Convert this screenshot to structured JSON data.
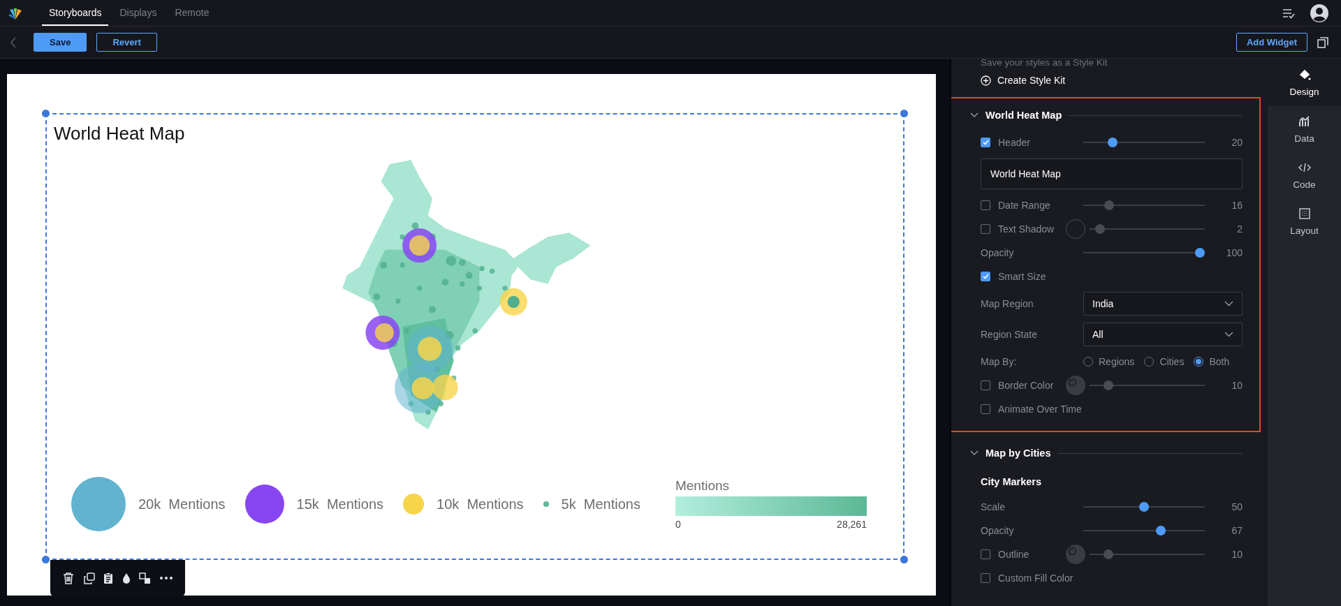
{
  "nav": {
    "tabs": [
      {
        "label": "Storyboards",
        "selected": true
      },
      {
        "label": "Displays",
        "selected": false
      },
      {
        "label": "Remote",
        "selected": false
      }
    ]
  },
  "toolbar": {
    "buttons": [
      {
        "label": "Save",
        "kind": "primary"
      },
      {
        "label": "Revert",
        "kind": "outline"
      }
    ],
    "add_widget": "Add Widget"
  },
  "widget": {
    "title": "World Heat Map",
    "legend": {
      "sizes": [
        {
          "label": "20k  Mentions",
          "color": "#62b3cf"
        },
        {
          "label": "15k  Mentions",
          "color": "#8746f2"
        },
        {
          "label": "10k  Mentions",
          "color": "#f7d44a"
        },
        {
          "label": "5k  Mentions",
          "color": "#5cb898"
        }
      ],
      "colorbar": {
        "title": "Mentions",
        "min": "0",
        "max": "28,261"
      }
    }
  },
  "panel": {
    "style_kit_hint": "Save your styles as a Style Kit",
    "create_style_kit": "Create Style Kit",
    "sections": [
      {
        "title": "World Heat Map",
        "expanded": true,
        "highlighted": true,
        "rows": [
          {
            "kind": "check-slider",
            "label": "Header",
            "checked": true,
            "level": 0.22,
            "reading": "20",
            "disabled": false
          },
          {
            "kind": "text-input",
            "value": "World Heat Map"
          },
          {
            "kind": "check-slider",
            "label": "Date Range",
            "checked": false,
            "level": 0.19,
            "reading": "16",
            "disabled": true
          },
          {
            "kind": "check-swatch-slider",
            "label": "Text Shadow",
            "checked": false,
            "swatch_filled": false,
            "level": 0.05,
            "reading": "2",
            "disabled": true
          },
          {
            "kind": "slider",
            "label": "Opacity",
            "level": 1,
            "reading": "100",
            "disabled": false
          },
          {
            "kind": "check",
            "label": "Smart Size",
            "checked": true
          },
          {
            "kind": "select",
            "label": "Map Region",
            "value": "India"
          },
          {
            "kind": "select",
            "label": "Region State",
            "value": "All"
          },
          {
            "kind": "radio",
            "label": "Map By:",
            "options": [
              {
                "label": "Regions",
                "selected": false
              },
              {
                "label": "Cities",
                "selected": false
              },
              {
                "label": "Both",
                "selected": true
              }
            ]
          },
          {
            "kind": "check-swatch-slider",
            "label": "Border Color",
            "checked": false,
            "swatch_filled": true,
            "level": 0.13,
            "reading": "10",
            "disabled": true
          },
          {
            "kind": "check",
            "label": "Animate Over Time",
            "checked": false
          }
        ]
      },
      {
        "title": "Map by Cities",
        "expanded": true,
        "highlighted": false,
        "rows": [
          {
            "kind": "subheading",
            "label": "City Markers"
          },
          {
            "kind": "slider",
            "label": "Scale",
            "level": 0.5,
            "reading": "50",
            "disabled": false
          },
          {
            "kind": "slider",
            "label": "Opacity",
            "level": 0.65,
            "reading": "67",
            "disabled": false
          },
          {
            "kind": "check-swatch-slider",
            "label": "Outline",
            "checked": false,
            "swatch_filled": true,
            "level": 0.13,
            "reading": "10",
            "disabled": true
          },
          {
            "kind": "check",
            "label": "Custom Fill Color",
            "checked": false
          }
        ]
      }
    ]
  },
  "side_tabs": [
    {
      "label": "Design",
      "selected": true
    },
    {
      "label": "Data",
      "selected": false
    },
    {
      "label": "Code",
      "selected": false
    },
    {
      "label": "Layout",
      "selected": false
    }
  ]
}
